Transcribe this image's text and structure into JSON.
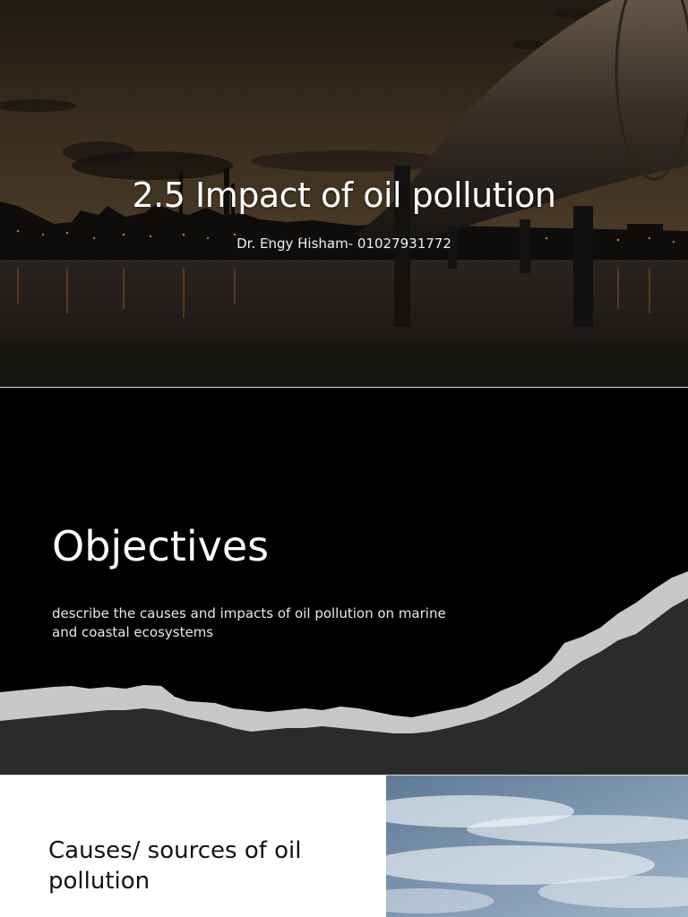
{
  "slides": [
    {
      "title": "2.5 Impact of oil pollution",
      "subtitle": "Dr. Engy Hisham- 01027931772",
      "background_image": "oil-pipeline-at-dusk"
    },
    {
      "title": "Objectives",
      "description": "describe the causes and impacts of oil pollution on marine and coastal ecosystems",
      "decoration": "torn-paper-edge"
    },
    {
      "title": "Causes/ sources of oil pollution",
      "side_image": "cloudy-sky"
    }
  ],
  "colors": {
    "slide1_sky": "#2a2218",
    "slide2_background": "#000000",
    "paper_edge": "#c8c8c8",
    "paper_fill": "#2b2b2b"
  }
}
